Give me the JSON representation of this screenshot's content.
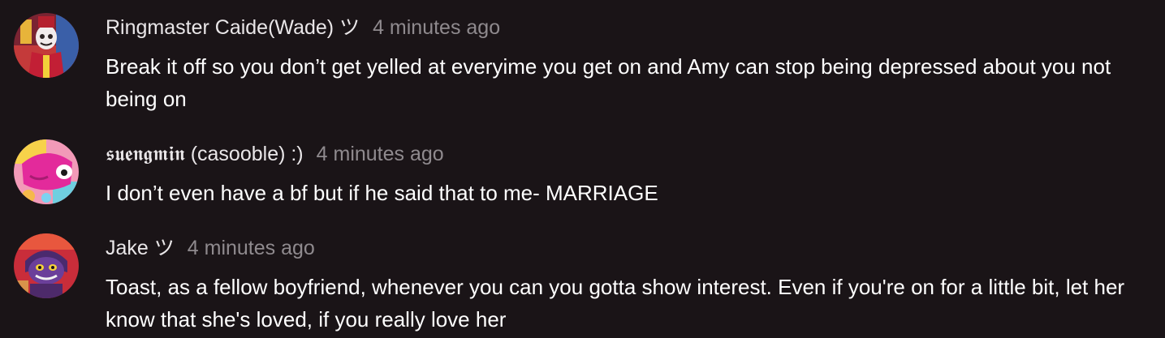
{
  "comments": [
    {
      "username": "Ringmaster Caide(Wade) ツ",
      "timestamp": "4 minutes ago",
      "text": "Break it off so you don’t get yelled at everyime you get on and Amy can stop being depressed about you not being on",
      "avatar_icon": "ringmaster-avatar"
    },
    {
      "username": "𝖘𝖚𝖊𝖓𝖌𝖒𝖎𝖓 (casooble) :)",
      "timestamp": "4 minutes ago",
      "text": "I don’t even have a bf but if he said that to me- MARRIAGE",
      "avatar_icon": "pink-character-avatar"
    },
    {
      "username": "Jake ツ",
      "timestamp": "4 minutes ago",
      "text": "Toast, as a fellow boyfriend, whenever you can you gotta show interest. Even if you're on for a little bit, let her know that she's loved, if you really love her",
      "avatar_icon": "jester-avatar"
    }
  ],
  "colors": {
    "background": "#1a1417",
    "username": "#e9e6e8",
    "timestamp": "#8f8a8e",
    "text": "#ffffff"
  }
}
